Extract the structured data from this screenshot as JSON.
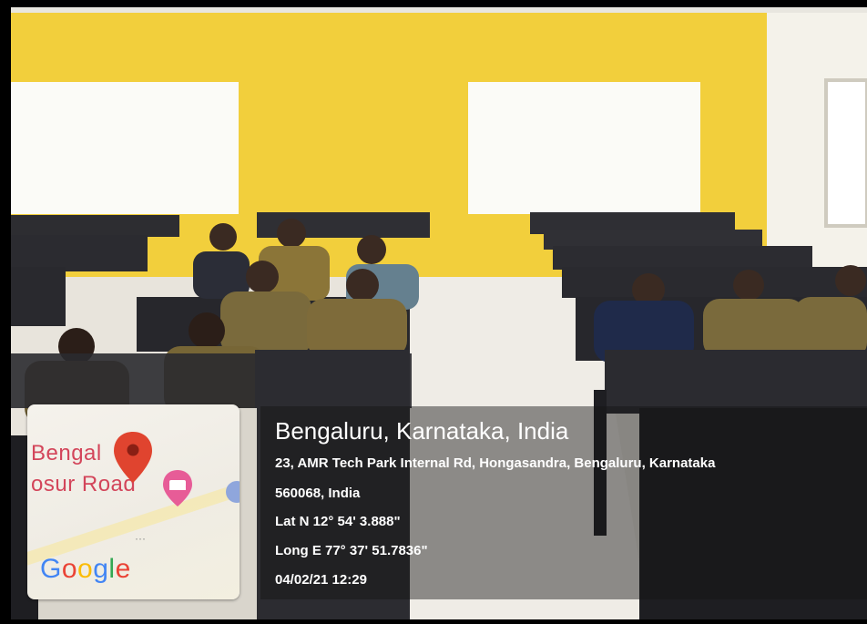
{
  "overlay": {
    "location_title": "Bengaluru, Karnataka, India",
    "address_line": "23, AMR Tech Park Internal Rd, Hongasandra, Bengaluru, Karnataka",
    "postal_line": "560068, India",
    "latitude": "Lat N 12° 54' 3.888\"",
    "longitude": "Long E 77° 37' 51.7836\"",
    "timestamp": "04/02/21 12:29"
  },
  "map": {
    "label_line1": "Bengal",
    "label_line2": "osur Road",
    "brand_letters": [
      "G",
      "o",
      "o",
      "g",
      "l",
      "e"
    ],
    "brand_colors": [
      "#4285f4",
      "#ea4335",
      "#fbbc05",
      "#4285f4",
      "#34a853",
      "#ea4335"
    ],
    "pin_color": "#e0442f",
    "icons": [
      "location-pin-icon",
      "hotel-bed-icon"
    ]
  },
  "colors": {
    "wall": "#f2cf3c",
    "uniform": "#7a6a3c"
  }
}
